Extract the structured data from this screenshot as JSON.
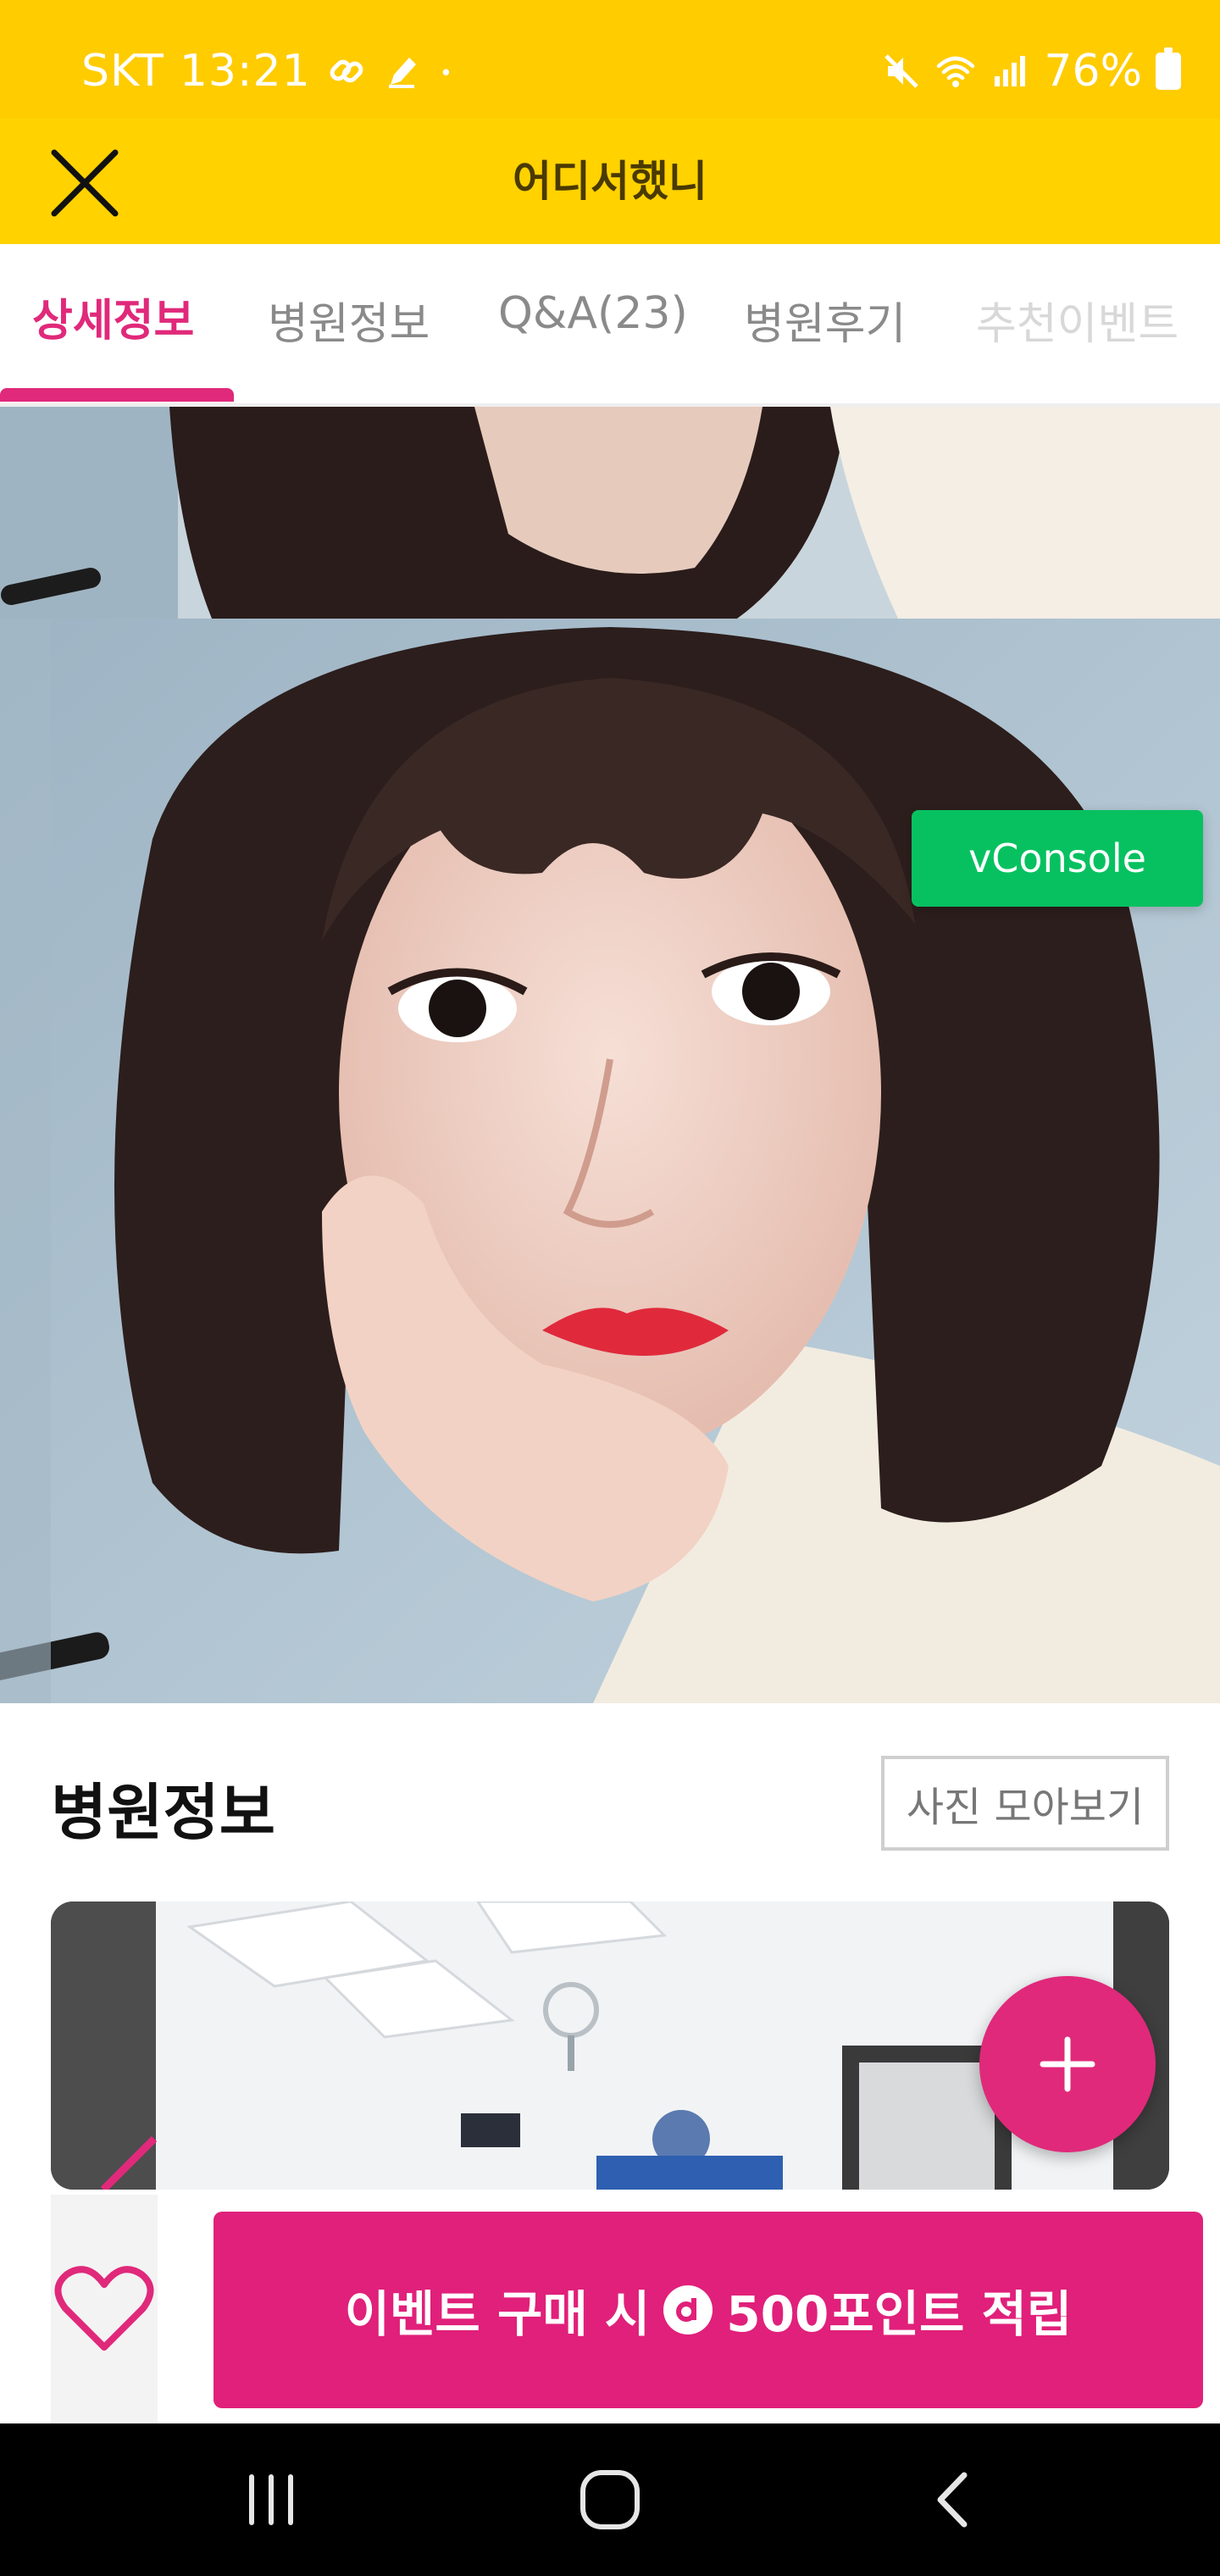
{
  "status_bar": {
    "carrier": "SKT",
    "time": "13:21",
    "battery": "76%",
    "icons": [
      "link-icon",
      "pen-icon",
      "dot-icon",
      "mute-icon",
      "wifi-icon",
      "signal-icon",
      "battery-icon"
    ]
  },
  "header": {
    "title": "어디서했니",
    "close_icon": "close-icon",
    "background": "#FFD200"
  },
  "tabs": [
    {
      "label": "상세정보",
      "active": true
    },
    {
      "label": "병원정보",
      "active": false
    },
    {
      "label": "Q&A(23)",
      "active": false
    },
    {
      "label": "병원후기",
      "active": false
    },
    {
      "label": "추천이벤트",
      "active": false
    }
  ],
  "vconsole": {
    "label": "vConsole"
  },
  "hospital_section": {
    "title": "병원정보",
    "gallery_button": "사진 모아보기"
  },
  "fab": {
    "icon": "plus-icon"
  },
  "action_bar": {
    "favorite_icon": "heart-icon",
    "buy_button_prefix": "이벤트 구매 시",
    "buy_button_suffix": "500포인트 적립",
    "point_icon": "point-logo-icon"
  },
  "nav_bar": {
    "icons": [
      "recent-apps-icon",
      "home-icon",
      "back-icon"
    ]
  },
  "colors": {
    "accent": "#E0297A",
    "header_yellow": "#FFD200",
    "status_yellow": "#FFCC00",
    "vconsole_green": "#07C160"
  }
}
